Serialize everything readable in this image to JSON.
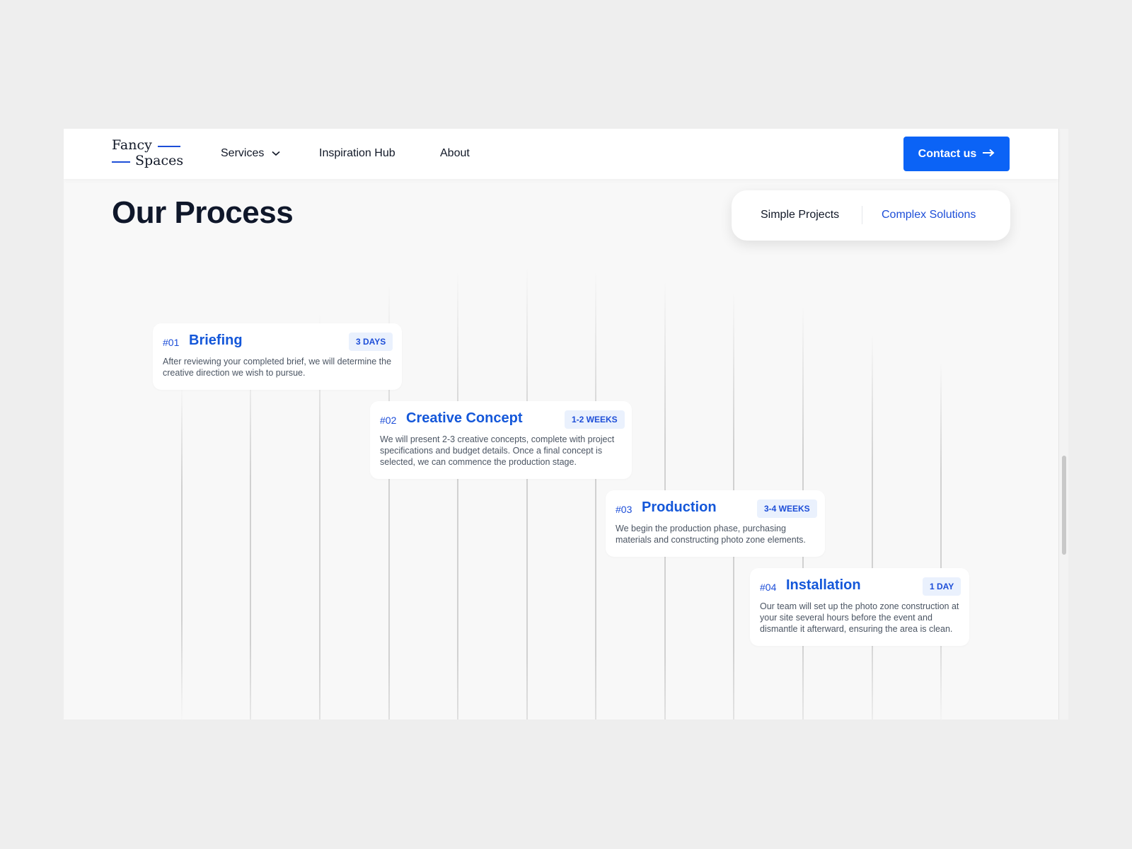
{
  "logo": {
    "line1": "Fancy",
    "line2": "Spaces"
  },
  "nav": {
    "services": "Services",
    "inspiration": "Inspiration Hub",
    "about": "About"
  },
  "contact_button": {
    "label": "Contact us"
  },
  "page_title": "Our Process",
  "toggle": {
    "option1": "Simple Projects",
    "option2": "Complex Solutions",
    "active": "Complex Solutions"
  },
  "steps": [
    {
      "num": "#01",
      "title": "Briefing",
      "duration": "3 DAYS",
      "desc": "After reviewing your completed brief, we will determine the creative direction we wish to pursue."
    },
    {
      "num": "#02",
      "title": "Creative Concept",
      "duration": "1-2 WEEKS",
      "desc": "We will present 2-3 creative concepts, complete with project specifications and budget details. Once a final concept is selected, we can commence the production stage."
    },
    {
      "num": "#03",
      "title": "Production",
      "duration": "3-4 WEEKS",
      "desc": "We begin the production phase, purchasing materials and constructing photo zone elements."
    },
    {
      "num": "#04",
      "title": "Installation",
      "duration": "1 DAY",
      "desc": "Our team will set up the photo zone construction at your site several hours before the event and dismantle it afterward, ensuring the area is clean."
    }
  ],
  "colors": {
    "accent": "#0b63f6",
    "title_blue": "#1457d9",
    "badge_bg": "#eaf1fd",
    "page_bg": "#f8f8f8",
    "outer_bg": "#eeeeee"
  },
  "icons": [
    "chevron-down-icon",
    "arrow-right-icon"
  ]
}
